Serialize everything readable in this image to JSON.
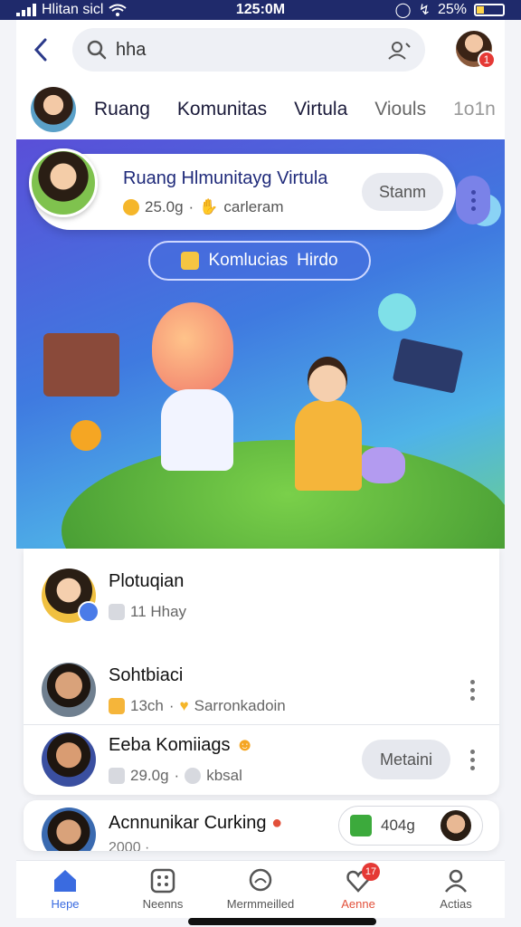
{
  "status_bar": {
    "carrier": "Hlitan sicl",
    "time": "125:0M",
    "battery": "25%",
    "battery_level": 0.25
  },
  "top_bar": {
    "search_value": "hha",
    "notification_count": "1"
  },
  "tabs": [
    {
      "label": "Ruang"
    },
    {
      "label": "Komunitas"
    },
    {
      "label": "Virtula"
    },
    {
      "label": "Viouls"
    },
    {
      "label": "1o1n"
    }
  ],
  "hero": {
    "title": "Ruang Hlmunitayg Virtula",
    "meta_count": "25.0g",
    "meta_label": "carleram",
    "action_label": "Stanm",
    "chip_label": "Komlucias",
    "chip_suffix": "Hirdo"
  },
  "list_items": [
    {
      "name": "Plotuqian",
      "meta": "11 Hhay"
    },
    {
      "name": "Sohtbiaci",
      "meta_a": "13ch",
      "meta_b": "Sarronkadoin"
    },
    {
      "name": "Eeba Komiiags",
      "meta_a": "29.0g",
      "meta_b": "kbsal",
      "action_label": "Metaini"
    }
  ],
  "partial_item": {
    "name": "Acnnunikar Curking",
    "meta": "2000 ·",
    "pill_value": "404g"
  },
  "bottom_nav": [
    {
      "label": "Hepe",
      "icon": "home-icon"
    },
    {
      "label": "Neenns",
      "icon": "grid-icon"
    },
    {
      "label": "Mermmeilled",
      "icon": "chat-icon"
    },
    {
      "label": "Aenne",
      "icon": "heart-icon",
      "badge": "17"
    },
    {
      "label": "Actias",
      "icon": "profile-icon"
    }
  ],
  "colors": {
    "status_bar_bg": "#1f2a6b",
    "accent": "#3a6be0",
    "alert": "#e53935"
  }
}
